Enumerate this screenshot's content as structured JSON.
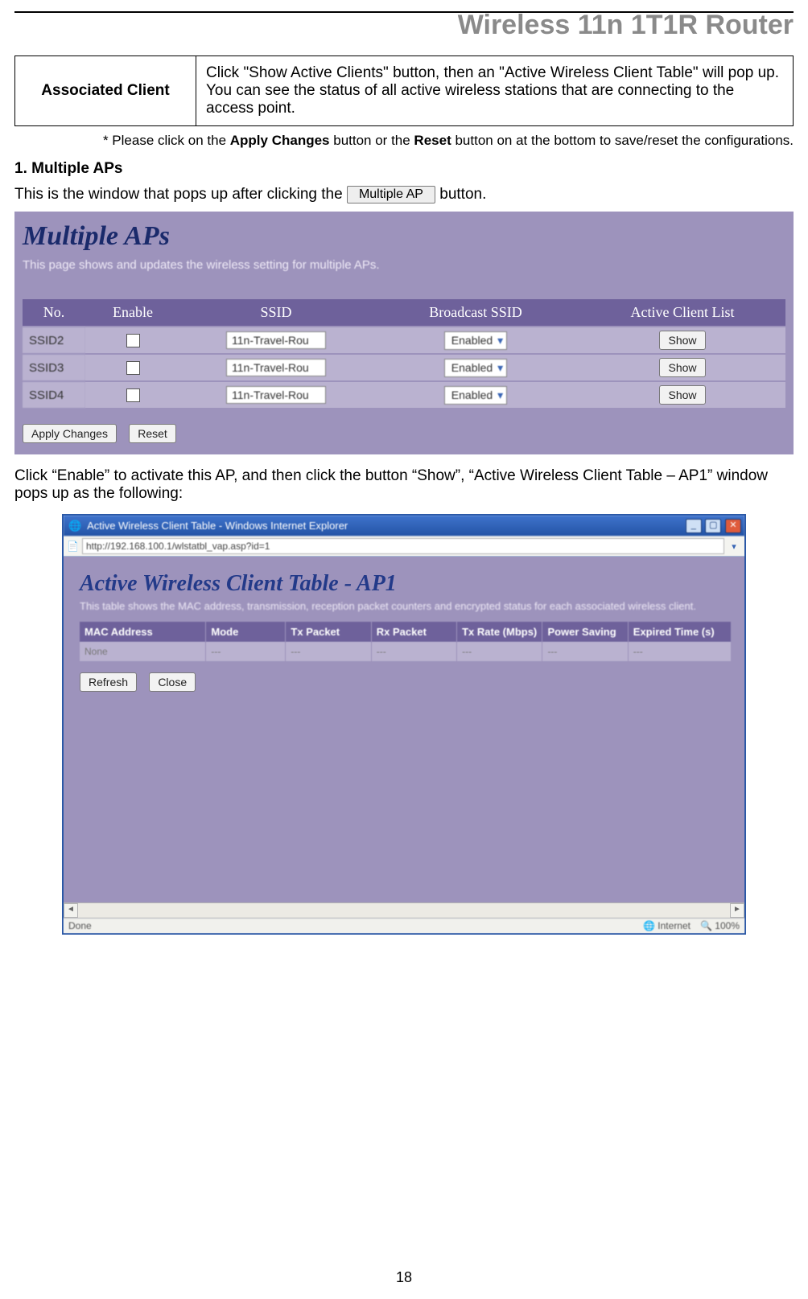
{
  "header": {
    "title": "Wireless 11n 1T1R Router"
  },
  "definition_table": {
    "label": "Associated Client",
    "description": "Click \"Show Active Clients\" button, then an \"Active Wireless Client Table\" will pop up. You can see the status of all active wireless stations that are connecting to the access point."
  },
  "note_parts": {
    "pre": "* Please click on the ",
    "apply": "Apply Changes",
    "mid": " button or the ",
    "reset": "Reset",
    "post": " button on at the bottom to save/reset the configurations."
  },
  "section1": {
    "heading": "1. Multiple APs",
    "intro_pre": "This is the window that pops up after clicking the ",
    "button_label": "Multiple AP",
    "intro_post": " button."
  },
  "multiple_ap_screen": {
    "title": "Multiple APs",
    "description": "This page shows and updates the wireless setting for multiple APs.",
    "columns": {
      "no": "No.",
      "enable": "Enable",
      "ssid": "SSID",
      "broadcast": "Broadcast SSID",
      "active": "Active Client List"
    },
    "rows": [
      {
        "no": "SSID2",
        "enable": false,
        "ssid": "11n-Travel-Rou",
        "broadcast": "Enabled",
        "show": "Show"
      },
      {
        "no": "SSID3",
        "enable": false,
        "ssid": "11n-Travel-Rou",
        "broadcast": "Enabled",
        "show": "Show"
      },
      {
        "no": "SSID4",
        "enable": false,
        "ssid": "11n-Travel-Rou",
        "broadcast": "Enabled",
        "show": "Show"
      }
    ],
    "buttons": {
      "apply": "Apply Changes",
      "reset": "Reset"
    }
  },
  "between_text": "Click “Enable” to activate this AP, and then click the button “Show”, “Active Wireless Client Table – AP1” window pops up as the following:",
  "ie_window": {
    "title": "Active Wireless Client Table - Windows Internet Explorer",
    "url": "http://192.168.100.1/wlstatbl_vap.asp?id=1",
    "body_title": "Active Wireless Client Table - AP1",
    "body_desc": "This table shows the MAC address, transmission, reception packet counters and encrypted status for each associated wireless client.",
    "columns": [
      "MAC Address",
      "Mode",
      "Tx Packet",
      "Rx Packet",
      "Tx Rate (Mbps)",
      "Power Saving",
      "Expired Time (s)"
    ],
    "row_label": "None",
    "cell": "---",
    "buttons": {
      "refresh": "Refresh",
      "close": "Close"
    },
    "status": {
      "done": "Done",
      "zone": "Internet",
      "zoom": "100%"
    }
  },
  "page_number": "18"
}
